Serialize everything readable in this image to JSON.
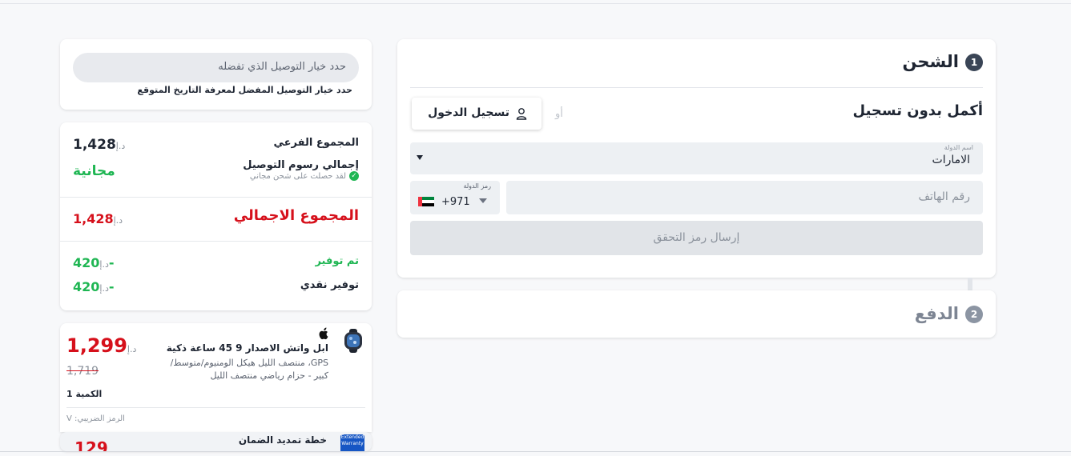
{
  "delivery": {
    "placeholder": "حدد خيار التوصيل الذي تفضله",
    "hint": "حدد خيار التوصيل المفضل لمعرفة التاريخ المتوقع"
  },
  "summary": {
    "currency": "د.إ",
    "subtotal_label": "المجموع الفرعي",
    "subtotal_value": "1,428",
    "shipping_label": "إجمالي رسوم التوصيل",
    "shipping_note": "لقد حصلت على شحن مجاني",
    "shipping_value": "مجانية",
    "total_label": "المجموع الاجمالي",
    "total_value": "1,428",
    "saved_label": "تم توفير",
    "saved_value": "420-",
    "cash_saving_label": "توفير نقدي",
    "cash_saving_value": "420-"
  },
  "product": {
    "title": "ابل واتش الاصدار 9 45 ساعة ذكية",
    "description": "GPS، منتصف الليل هيكل الومنيوم/متوسط/كبير - حزام رياضي منتصف الليل",
    "currency": "د.إ",
    "price": "1,299",
    "old_price": "1,719",
    "quantity": "الكمية 1",
    "tax_code": "الرمز الضريبي: V"
  },
  "warranty": {
    "title": "خطة تمديد الضمان",
    "icon_text": "Extended Warranty",
    "price": "129"
  },
  "shipping": {
    "step_number": "1",
    "title": "الشحن",
    "guest_title": "أكمل بدون تسجيل",
    "or_label": "أو",
    "login_label": "تسجيل الدخول",
    "country_label": "اسم الدولة",
    "country_value": "الامارات",
    "phone_placeholder": "رقم الهاتف",
    "code_label": "رمز الدولة",
    "code_value": "+971",
    "verify_label": "إرسال رمز التحقق"
  },
  "payment": {
    "step_number": "2",
    "title": "الدفع"
  },
  "colors": {
    "accent_green": "#1fb653",
    "price_red": "#d6101b",
    "step_active": "#3a4556",
    "step_inactive": "#8c95a3"
  }
}
